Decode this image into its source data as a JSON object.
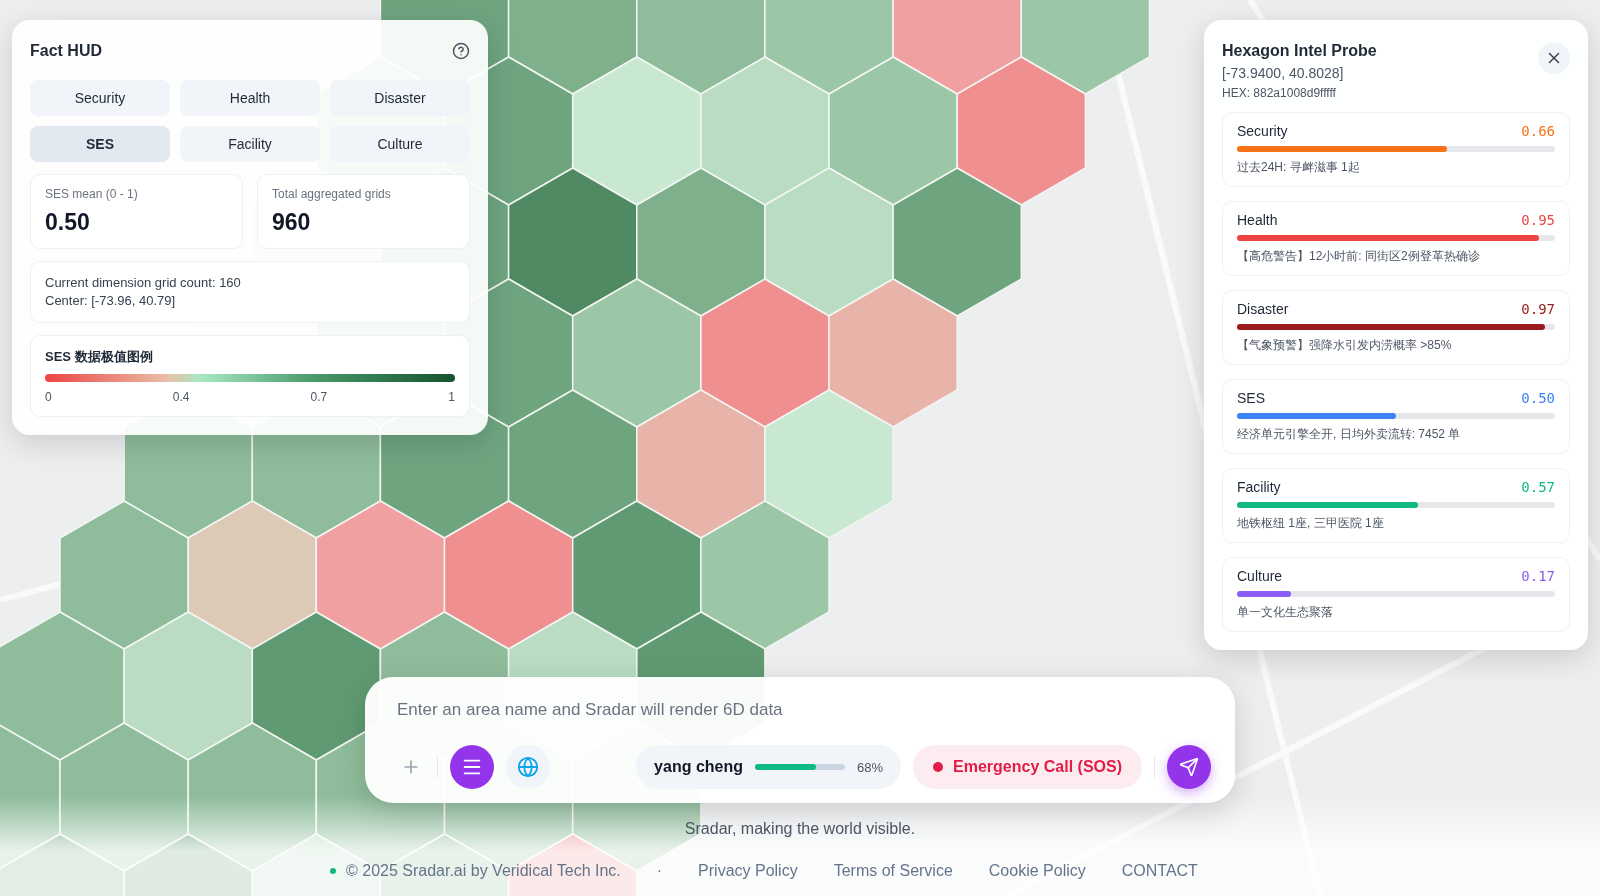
{
  "fact_hud": {
    "title": "Fact HUD",
    "tabs": [
      {
        "label": "Security",
        "selected": false
      },
      {
        "label": "Health",
        "selected": false
      },
      {
        "label": "Disaster",
        "selected": false
      },
      {
        "label": "SES",
        "selected": true
      },
      {
        "label": "Facility",
        "selected": false
      },
      {
        "label": "Culture",
        "selected": false
      }
    ],
    "stats": [
      {
        "label": "SES mean (0 - 1)",
        "value": "0.50"
      },
      {
        "label": "Total aggregated grids",
        "value": "960"
      }
    ],
    "info_lines": [
      "Current dimension grid count: 160",
      "Center: [-73.96, 40.79]"
    ],
    "legend": {
      "title": "SES 数据极值图例",
      "ticks": [
        "0",
        "0.4",
        "0.7",
        "1"
      ]
    }
  },
  "probe": {
    "title": "Hexagon Intel Probe",
    "coords": "[-73.9400, 40.8028]",
    "hex": "HEX: 882a1008d9fffff",
    "metrics": [
      {
        "name": "Security",
        "value": "0.66",
        "level": 0.66,
        "color": "#f97316",
        "note": "过去24H: 寻衅滋事 1起"
      },
      {
        "name": "Health",
        "value": "0.95",
        "level": 0.95,
        "color": "#ef4444",
        "note": "【高危警告】12小时前: 同街区2例登革热确诊"
      },
      {
        "name": "Disaster",
        "value": "0.97",
        "level": 0.97,
        "color": "#991b1b",
        "note": "【气象预警】强降水引发内涝概率 >85%"
      },
      {
        "name": "SES",
        "value": "0.50",
        "level": 0.5,
        "color": "#3b82f6",
        "note": "经济单元引擎全开, 日均外卖流转: 7452 单"
      },
      {
        "name": "Facility",
        "value": "0.57",
        "level": 0.57,
        "color": "#10b981",
        "note": "地铁枢纽 1座, 三甲医院 1座"
      },
      {
        "name": "Culture",
        "value": "0.17",
        "level": 0.17,
        "color": "#8b5cf6",
        "note": "单一文化生态聚落"
      }
    ]
  },
  "search": {
    "placeholder": "Enter an area name and Sradar will render 6D data",
    "user": {
      "name": "yang cheng",
      "level": 0.68,
      "reading": "68%"
    },
    "sos": {
      "label": "Emergency Call (SOS)"
    }
  },
  "tagline": "Sradar, making the world visible.",
  "footer": {
    "copyright": "© 2025 Sradar.ai by Veridical Tech Inc.",
    "separator": "·",
    "links": [
      "Privacy Policy",
      "Terms of Service",
      "Cookie Policy",
      "CONTACT"
    ]
  }
}
